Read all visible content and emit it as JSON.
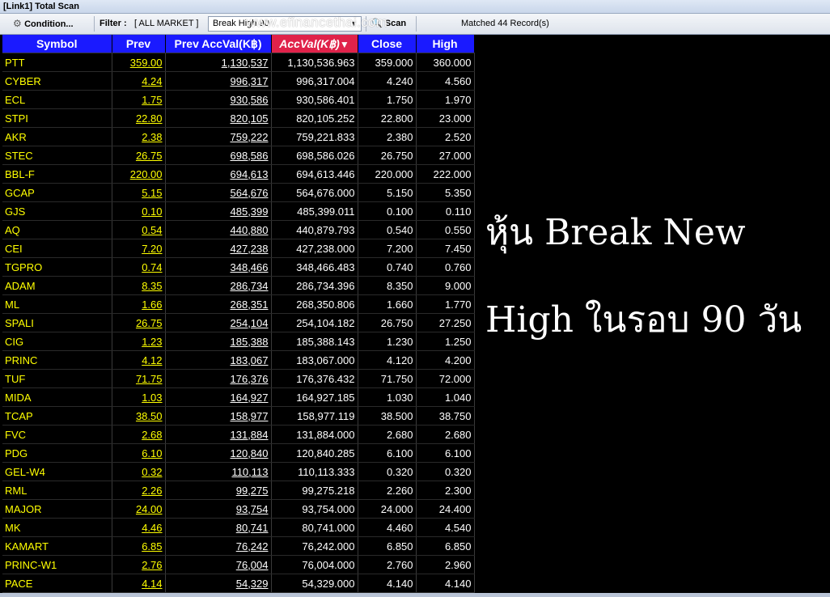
{
  "window": {
    "title": "[Link1] Total Scan"
  },
  "toolbar": {
    "condition_label": "Condition...",
    "filter_label": "Filter :",
    "filter_value": "[ ALL MARKET ]",
    "scan_selected": "Break High 90",
    "scan_label": "Scan",
    "matched_text": "Matched 44 Record(s)"
  },
  "watermark": "www.efinancethai.com",
  "table": {
    "headers": [
      "Symbol",
      "Prev",
      "Prev AccVal(K฿)",
      "AccVal(K฿)",
      "Close",
      "High"
    ],
    "sort_indicator": "▼",
    "rows": [
      [
        "PTT",
        "359.00",
        "1,130,537",
        "1,130,536.963",
        "359.000",
        "360.000"
      ],
      [
        "CYBER",
        "4.24",
        "996,317",
        "996,317.004",
        "4.240",
        "4.560"
      ],
      [
        "ECL",
        "1.75",
        "930,586",
        "930,586.401",
        "1.750",
        "1.970"
      ],
      [
        "STPI",
        "22.80",
        "820,105",
        "820,105.252",
        "22.800",
        "23.000"
      ],
      [
        "AKR",
        "2.38",
        "759,222",
        "759,221.833",
        "2.380",
        "2.520"
      ],
      [
        "STEC",
        "26.75",
        "698,586",
        "698,586.026",
        "26.750",
        "27.000"
      ],
      [
        "BBL-F",
        "220.00",
        "694,613",
        "694,613.446",
        "220.000",
        "222.000"
      ],
      [
        "GCAP",
        "5.15",
        "564,676",
        "564,676.000",
        "5.150",
        "5.350"
      ],
      [
        "GJS",
        "0.10",
        "485,399",
        "485,399.011",
        "0.100",
        "0.110"
      ],
      [
        "AQ",
        "0.54",
        "440,880",
        "440,879.793",
        "0.540",
        "0.550"
      ],
      [
        "CEI",
        "7.20",
        "427,238",
        "427,238.000",
        "7.200",
        "7.450"
      ],
      [
        "TGPRO",
        "0.74",
        "348,466",
        "348,466.483",
        "0.740",
        "0.760"
      ],
      [
        "ADAM",
        "8.35",
        "286,734",
        "286,734.396",
        "8.350",
        "9.000"
      ],
      [
        "ML",
        "1.66",
        "268,351",
        "268,350.806",
        "1.660",
        "1.770"
      ],
      [
        "SPALI",
        "26.75",
        "254,104",
        "254,104.182",
        "26.750",
        "27.250"
      ],
      [
        "CIG",
        "1.23",
        "185,388",
        "185,388.143",
        "1.230",
        "1.250"
      ],
      [
        "PRINC",
        "4.12",
        "183,067",
        "183,067.000",
        "4.120",
        "4.200"
      ],
      [
        "TUF",
        "71.75",
        "176,376",
        "176,376.432",
        "71.750",
        "72.000"
      ],
      [
        "MIDA",
        "1.03",
        "164,927",
        "164,927.185",
        "1.030",
        "1.040"
      ],
      [
        "TCAP",
        "38.50",
        "158,977",
        "158,977.119",
        "38.500",
        "38.750"
      ],
      [
        "FVC",
        "2.68",
        "131,884",
        "131,884.000",
        "2.680",
        "2.680"
      ],
      [
        "PDG",
        "6.10",
        "120,840",
        "120,840.285",
        "6.100",
        "6.100"
      ],
      [
        "GEL-W4",
        "0.32",
        "110,113",
        "110,113.333",
        "0.320",
        "0.320"
      ],
      [
        "RML",
        "2.26",
        "99,275",
        "99,275.218",
        "2.260",
        "2.300"
      ],
      [
        "MAJOR",
        "24.00",
        "93,754",
        "93,754.000",
        "24.000",
        "24.400"
      ],
      [
        "MK",
        "4.46",
        "80,741",
        "80,741.000",
        "4.460",
        "4.540"
      ],
      [
        "KAMART",
        "6.85",
        "76,242",
        "76,242.000",
        "6.850",
        "6.850"
      ],
      [
        "PRINC-W1",
        "2.76",
        "76,004",
        "76,004.000",
        "2.760",
        "2.960"
      ],
      [
        "PACE",
        "4.14",
        "54,329",
        "54,329.000",
        "4.140",
        "4.140"
      ]
    ]
  },
  "caption": {
    "line1": "หุ้น Break New",
    "line2": "High ในรอบ 90 วัน"
  },
  "colors": {
    "header_bg": "#1a1aff",
    "sorted_header_bg": "#e0224a",
    "symbol_text": "#ffff00",
    "value_text": "#ffffff",
    "background": "#000000"
  }
}
